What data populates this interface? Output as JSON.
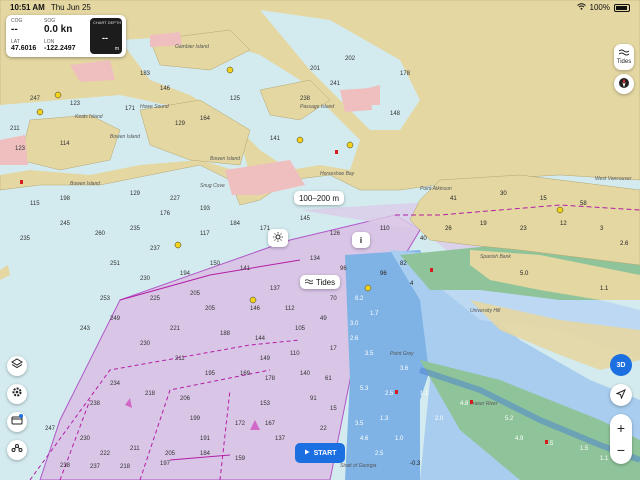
{
  "status_bar": {
    "time": "10:51 AM",
    "date": "Thu Jun 25",
    "battery": "100%"
  },
  "instruments": {
    "cog_label": "COG",
    "cog_value": "--",
    "sog_label": "SOG",
    "sog_value": "0.0 kn",
    "lat_label": "LAT",
    "lat_value": "47.6016",
    "lon_label": "LON",
    "lon_value": "-122.2497",
    "depth_label": "CHART DEPTH",
    "depth_value": "--",
    "depth_unit": "m"
  },
  "right_controls": {
    "tides_label": "Tides",
    "btn_3d": "3D"
  },
  "map_bubbles": {
    "depth_range": "100–200 m",
    "tides": "Tides",
    "info": "i"
  },
  "start_button": "START",
  "place_labels": [
    "Gambier Island",
    "Howe Sound",
    "Keats Island",
    "Bowen Island",
    "Bowen Island",
    "Passage Island",
    "Horseshoe Bay",
    "West Vancouver",
    "Point Atkinson",
    "Spanish Bank",
    "University Hill",
    "Point Grey",
    "Fraser River",
    "Strait of Georgia",
    "Snug Cove"
  ],
  "icons": [
    "wifi-icon",
    "battery-icon",
    "layers-icon",
    "gear-icon",
    "bookmarks-icon",
    "route-icon",
    "compass-icon",
    "location-arrow-icon",
    "zoom-in-icon",
    "zoom-out-icon",
    "play-icon",
    "sun-icon",
    "waves-icon"
  ]
}
